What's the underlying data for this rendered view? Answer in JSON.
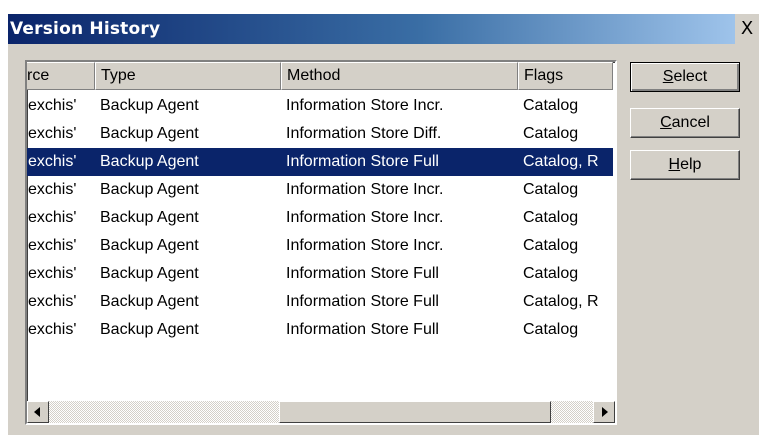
{
  "window": {
    "title": "Version History",
    "close_glyph": "X"
  },
  "list": {
    "columns": [
      "rce",
      "Type",
      "Method",
      "Flags"
    ],
    "rows": [
      {
        "source": "exchis'",
        "type": "Backup Agent",
        "method": "Information Store Incr.",
        "flags": "Catalog",
        "selected": false
      },
      {
        "source": "exchis'",
        "type": "Backup Agent",
        "method": "Information Store Diff.",
        "flags": "Catalog",
        "selected": false
      },
      {
        "source": "exchis'",
        "type": "Backup Agent",
        "method": "Information Store Full",
        "flags": "Catalog, R",
        "selected": true
      },
      {
        "source": "exchis'",
        "type": "Backup Agent",
        "method": "Information Store Incr.",
        "flags": "Catalog",
        "selected": false
      },
      {
        "source": "exchis'",
        "type": "Backup Agent",
        "method": "Information Store Incr.",
        "flags": "Catalog",
        "selected": false
      },
      {
        "source": "exchis'",
        "type": "Backup Agent",
        "method": "Information Store Incr.",
        "flags": "Catalog",
        "selected": false
      },
      {
        "source": "exchis'",
        "type": "Backup Agent",
        "method": "Information Store Full",
        "flags": "Catalog",
        "selected": false
      },
      {
        "source": "exchis'",
        "type": "Backup Agent",
        "method": "Information Store Full",
        "flags": "Catalog, R",
        "selected": false
      },
      {
        "source": "exchis'",
        "type": "Backup Agent",
        "method": "Information Store Full",
        "flags": "Catalog",
        "selected": false
      }
    ]
  },
  "buttons": {
    "select": {
      "mnemonic": "S",
      "rest": "elect"
    },
    "cancel": {
      "mnemonic": "C",
      "rest": "ancel"
    },
    "help": {
      "mnemonic": "H",
      "rest": "elp"
    }
  },
  "icons": {
    "scroll_left": "left-arrow-icon",
    "scroll_right": "right-arrow-icon"
  },
  "colors": {
    "title_gradient_start": "#0a246a",
    "title_gradient_end": "#a6caf0",
    "selection": "#0a246a",
    "face": "#d4d0c8"
  }
}
